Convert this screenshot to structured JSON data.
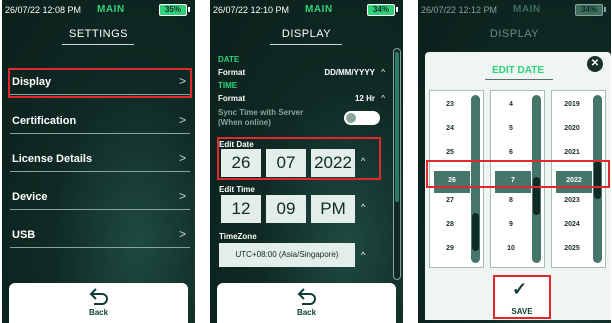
{
  "colors": {
    "accent": "#2fd27a",
    "highlight": "#e0282e",
    "background": "#0f2a24"
  },
  "screen1": {
    "status": {
      "time": "26/07/22 12:08 PM",
      "mode": "MAIN",
      "battery": "35%"
    },
    "title": "SETTINGS",
    "menu": [
      {
        "label": "Display"
      },
      {
        "label": "Certification"
      },
      {
        "label": "License Details"
      },
      {
        "label": "Device"
      },
      {
        "label": "USB"
      }
    ],
    "back_label": "Back"
  },
  "screen2": {
    "status": {
      "time": "26/07/22 12:10 PM",
      "mode": "MAIN",
      "battery": "34%"
    },
    "title": "DISPLAY",
    "date_section": "DATE",
    "format_label": "Format",
    "date_format": "DD/MM/YYYY",
    "time_section": "TIME",
    "time_format": "12 Hr",
    "sync_text_1": "Sync Time with Server",
    "sync_text_2": "(When online)",
    "edit_date_label": "Edit Date",
    "edit_date": {
      "day": "26",
      "month": "07",
      "year": "2022"
    },
    "edit_time_label": "Edit Time",
    "edit_time": {
      "hour": "12",
      "minute": "09",
      "ampm": "PM"
    },
    "timezone_label": "TimeZone",
    "timezone": "UTC+08:00 (Asia/Singapore)",
    "back_label": "Back"
  },
  "screen3": {
    "status": {
      "time": "26/07/22 12:12 PM",
      "mode": "MAIN",
      "battery": "34%"
    },
    "title": "DISPLAY",
    "dialog_title": "EDIT DATE",
    "day_column": [
      "23",
      "24",
      "25",
      "26",
      "27",
      "28",
      "29"
    ],
    "month_column": [
      "4",
      "5",
      "6",
      "7",
      "8",
      "9",
      "10"
    ],
    "year_column": [
      "2019",
      "2020",
      "2021",
      "2022",
      "2023",
      "2024",
      "2025"
    ],
    "selected": {
      "day": "26",
      "month": "7",
      "year": "2022"
    },
    "save_label": "SAVE",
    "save_icon": "checkmark-icon"
  }
}
